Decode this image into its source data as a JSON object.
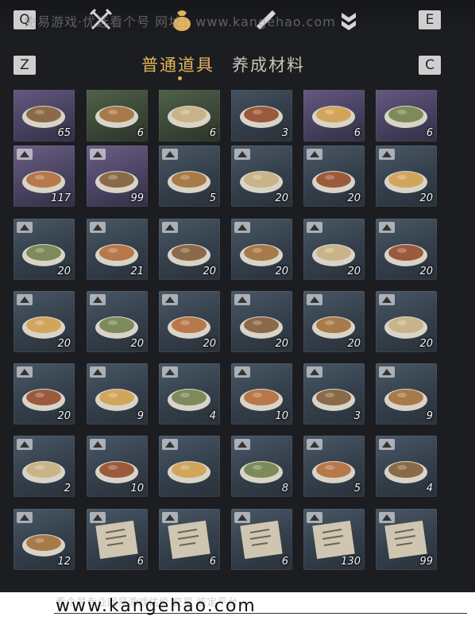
{
  "keys": {
    "q": "Q",
    "e": "E",
    "z": "Z",
    "c": "C"
  },
  "watermark": "免易游戏·优选看个号 网址：www.kangehao.com",
  "tabs": [
    {
      "label": "普通道具",
      "active": true
    },
    {
      "label": "养成材料",
      "active": false
    }
  ],
  "inventory": {
    "rows": [
      [
        "65",
        "6",
        "6",
        "3",
        "6",
        "6"
      ],
      [
        "117",
        "99",
        "5",
        "20",
        "20",
        "20"
      ],
      [
        "20",
        "21",
        "20",
        "20",
        "20",
        "20"
      ],
      [
        "20",
        "20",
        "20",
        "20",
        "20",
        "20"
      ],
      [
        "20",
        "9",
        "4",
        "10",
        "3",
        "9"
      ],
      [
        "2",
        "10",
        "",
        "8",
        "5",
        "4"
      ],
      [
        "12",
        "6",
        "6",
        "6",
        "130",
        "99"
      ]
    ]
  },
  "footer": {
    "url": "www.kangehao.com",
    "slogan": "看个号专业网易游戏估价 交易 鉴定平台"
  },
  "colors": {
    "accent": "#e2b35e",
    "rare": "#6b5f86",
    "common": "#4a5866"
  }
}
